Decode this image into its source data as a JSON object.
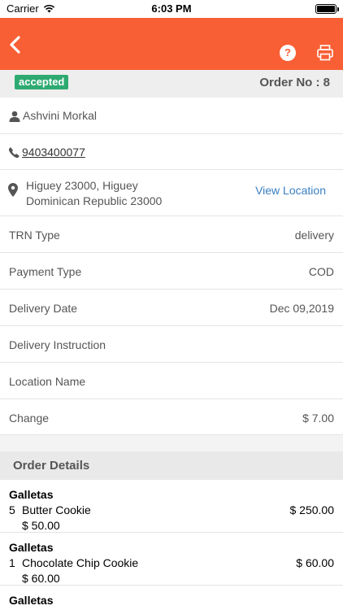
{
  "status_bar": {
    "carrier": "Carrier",
    "time": "6:03 PM"
  },
  "nav": {
    "help_label": "?"
  },
  "order": {
    "status": "accepted",
    "order_no": "Order No : 8"
  },
  "customer": {
    "name": "Ashvini Morkal",
    "phone": "9403400077",
    "address_line1": "Higuey 23000, Higuey",
    "address_line2": "Dominican Republic 23000",
    "view_location_label": "View Location"
  },
  "fields": [
    {
      "label": "TRN Type",
      "value": "delivery"
    },
    {
      "label": "Payment Type",
      "value": "COD"
    },
    {
      "label": "Delivery Date",
      "value": "Dec 09,2019"
    },
    {
      "label": "Delivery Instruction",
      "value": ""
    },
    {
      "label": "Location Name",
      "value": ""
    },
    {
      "label": "Change",
      "value": "$ 7.00"
    }
  ],
  "order_details": {
    "title": "Order Details",
    "items": [
      {
        "category": "Galletas",
        "qty": "5",
        "name": "Butter Cookie",
        "unit_price": "$ 50.00",
        "total": "$ 250.00"
      },
      {
        "category": "Galletas",
        "qty": "1",
        "name": "Chocolate Chip Cookie",
        "unit_price": "$ 60.00",
        "total": "$ 60.00"
      },
      {
        "category": "Galletas"
      }
    ]
  },
  "colors": {
    "nav_bar": "#f95f35",
    "badge": "#2eaa71",
    "link": "#3a7fc1"
  },
  "icons": {
    "back": "chevron-left-icon",
    "help": "question-circle-icon",
    "print": "printer-icon",
    "person": "person-icon",
    "phone": "phone-icon",
    "location": "map-pin-icon",
    "wifi": "wifi-icon",
    "battery": "battery-icon"
  }
}
